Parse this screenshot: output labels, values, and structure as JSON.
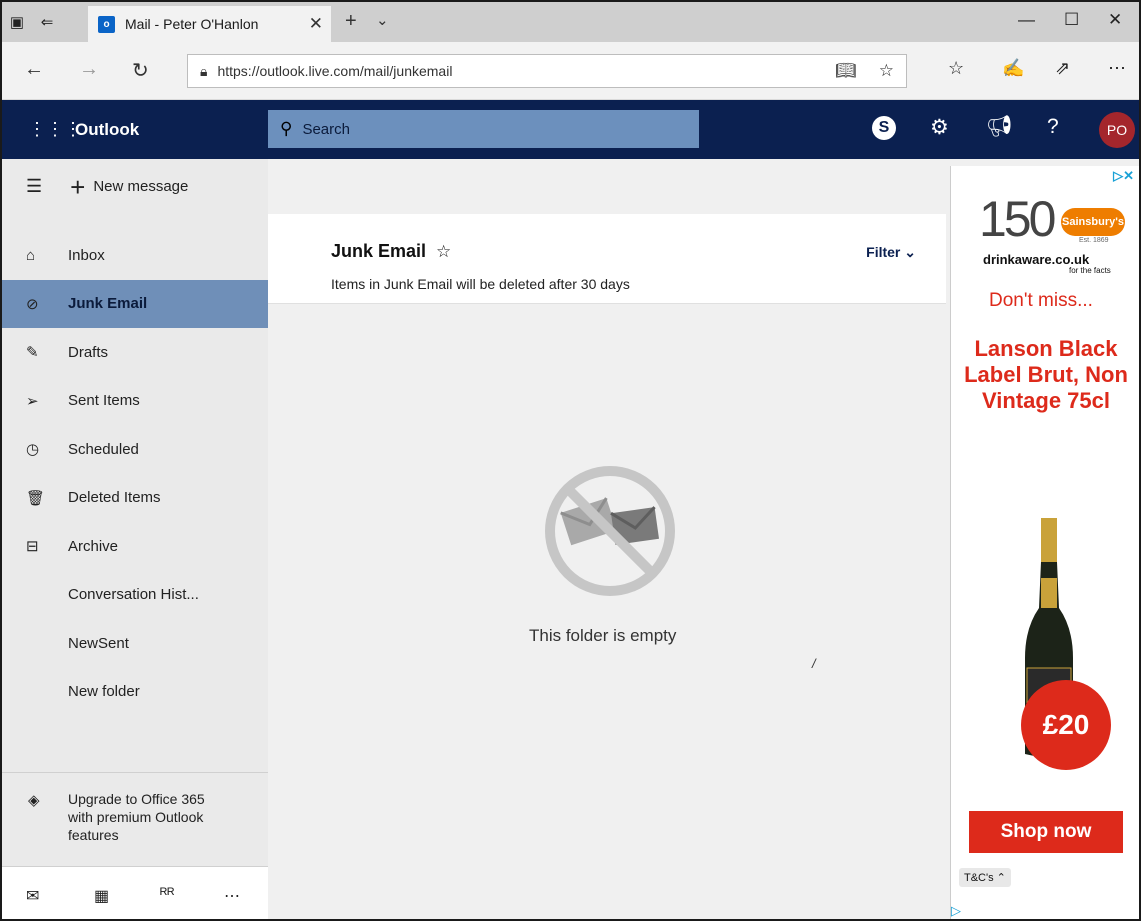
{
  "browser": {
    "tab_title": "Mail - Peter O'Hanlon",
    "tab_icon_text": "o",
    "url": "https://outlook.live.com/mail/junkemail"
  },
  "outlook": {
    "brand": "Outlook",
    "search_placeholder": "Search",
    "avatar_initials": "PO",
    "skype_letter": "S",
    "accent_color": "#0b2050"
  },
  "commands": {
    "new_message": "New message"
  },
  "folders": [
    {
      "label": "Inbox",
      "icon": "inbox-icon"
    },
    {
      "label": "Junk Email",
      "icon": "blocked-icon",
      "active": true
    },
    {
      "label": "Drafts",
      "icon": "pencil-icon"
    },
    {
      "label": "Sent Items",
      "icon": "send-icon"
    },
    {
      "label": "Scheduled",
      "icon": "clock-icon"
    },
    {
      "label": "Deleted Items",
      "icon": "trash-icon"
    },
    {
      "label": "Archive",
      "icon": "archive-icon"
    },
    {
      "label": "Conversation Hist...",
      "icon": ""
    },
    {
      "label": "NewSent",
      "icon": ""
    },
    {
      "label": "New folder",
      "icon": ""
    }
  ],
  "upgrade": {
    "text": "Upgrade to Office 365 with premium Outlook features"
  },
  "main": {
    "folder_title": "Junk Email",
    "filter_label": "Filter",
    "note": "Items in Junk Email will be deleted after 30 days",
    "empty_text": "This folder is empty",
    "stray_mark": "/"
  },
  "ad": {
    "anniversary": "150",
    "brand": "Sainsbury's",
    "est": "Est. 1869",
    "drinkaware": "drinkaware.co.uk",
    "for_facts": "for the facts",
    "headline": "Don't miss...",
    "product": "Lanson Black Label Brut, Non Vintage 75cl",
    "price": "£20",
    "cta": "Shop now",
    "tcs": "T&C's"
  }
}
